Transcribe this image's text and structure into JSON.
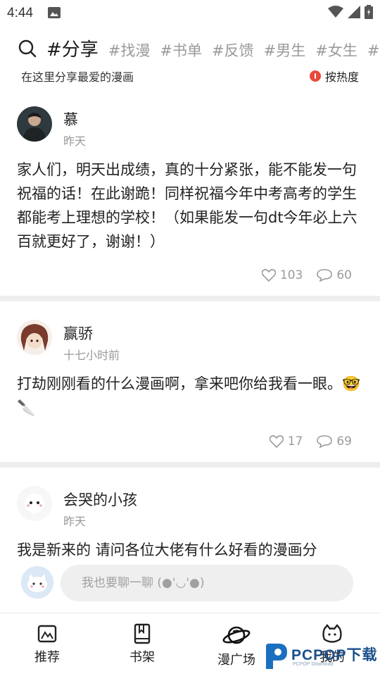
{
  "status_bar": {
    "time": "4:44"
  },
  "topics": {
    "tabs": [
      {
        "label": "#分享",
        "active": true
      },
      {
        "label": "#找漫",
        "active": false
      },
      {
        "label": "#书单",
        "active": false
      },
      {
        "label": "#反馈",
        "active": false
      },
      {
        "label": "#男生",
        "active": false
      },
      {
        "label": "#女生",
        "active": false
      },
      {
        "label": "#耶",
        "active": false
      }
    ]
  },
  "subheader": {
    "description": "在这里分享最爱的漫画",
    "sort_label": "按热度"
  },
  "posts": [
    {
      "author": "慕",
      "time": "昨天",
      "content": "家人们，明天出成绩，真的十分紧张，能不能发一句祝福的话！在此谢跪！同样祝福今年中考高考的学生都能考上理想的学校！（如果能发一句dt今年必上六百就更好了，谢谢！）",
      "likes": "103",
      "comments": "60"
    },
    {
      "author": "赢骄",
      "time": "十七小时前",
      "content": "打劫刚刚看的什么漫画啊，拿来吧你给我看一眼。🤓🔪",
      "likes": "17",
      "comments": "69"
    },
    {
      "author": "会哭的小孩",
      "time": "昨天",
      "content": "我是新来的  请问各位大佬有什么好看的漫画分"
    }
  ],
  "composer": {
    "placeholder": "我也要聊一聊 (●'◡'●)"
  },
  "tabbar": {
    "items": [
      {
        "label": "推荐",
        "icon": "recommend-icon"
      },
      {
        "label": "书架",
        "icon": "bookshelf-icon"
      },
      {
        "label": "漫广场",
        "icon": "planet-icon"
      },
      {
        "label": "我的",
        "icon": "cat-face-icon"
      }
    ]
  },
  "watermark": {
    "brand": "PCPOP下载",
    "sub": "PCPOP Download"
  },
  "colors": {
    "accent_red": "#e84a3a",
    "muted_text": "#999999",
    "separator": "#eeeeee"
  }
}
